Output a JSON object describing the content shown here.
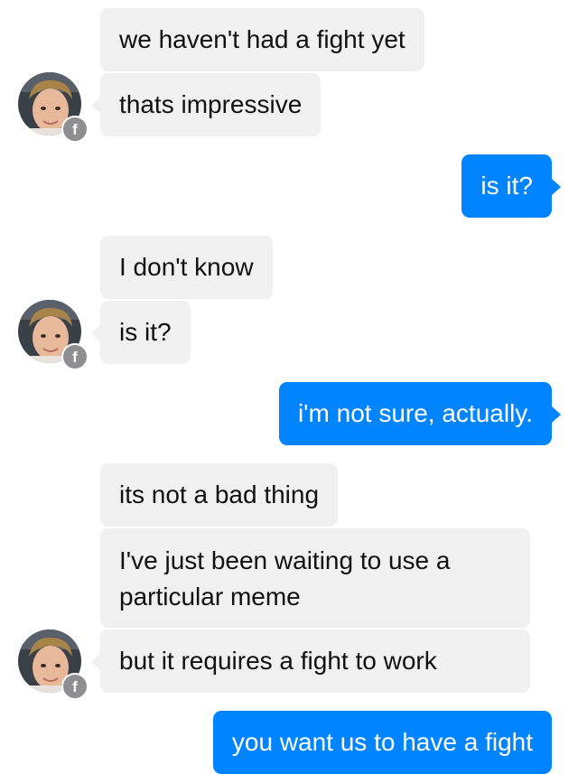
{
  "colors": {
    "incoming_bubble": "#f1f0f0",
    "outgoing_bubble": "#0084ff",
    "incoming_text": "#111111",
    "outgoing_text": "#ffffff",
    "badge": "#8e8e93"
  },
  "contact": {
    "avatar_icon": "profile-photo-icon",
    "badge_icon": "facebook-icon",
    "badge_glyph": "f"
  },
  "messages": [
    {
      "sender": "them",
      "text": "we haven't had a fight yet"
    },
    {
      "sender": "them",
      "text": "thats impressive"
    },
    {
      "sender": "me",
      "text": "is it?"
    },
    {
      "sender": "them",
      "text": "I don't know"
    },
    {
      "sender": "them",
      "text": "is it?"
    },
    {
      "sender": "me",
      "text": "i'm not sure, actually."
    },
    {
      "sender": "them",
      "text": "its not a bad thing"
    },
    {
      "sender": "them",
      "text": "I've just been waiting to use a particular meme"
    },
    {
      "sender": "them",
      "text": "but it requires a fight to work"
    },
    {
      "sender": "me",
      "text": "you want us to have a fight"
    }
  ]
}
